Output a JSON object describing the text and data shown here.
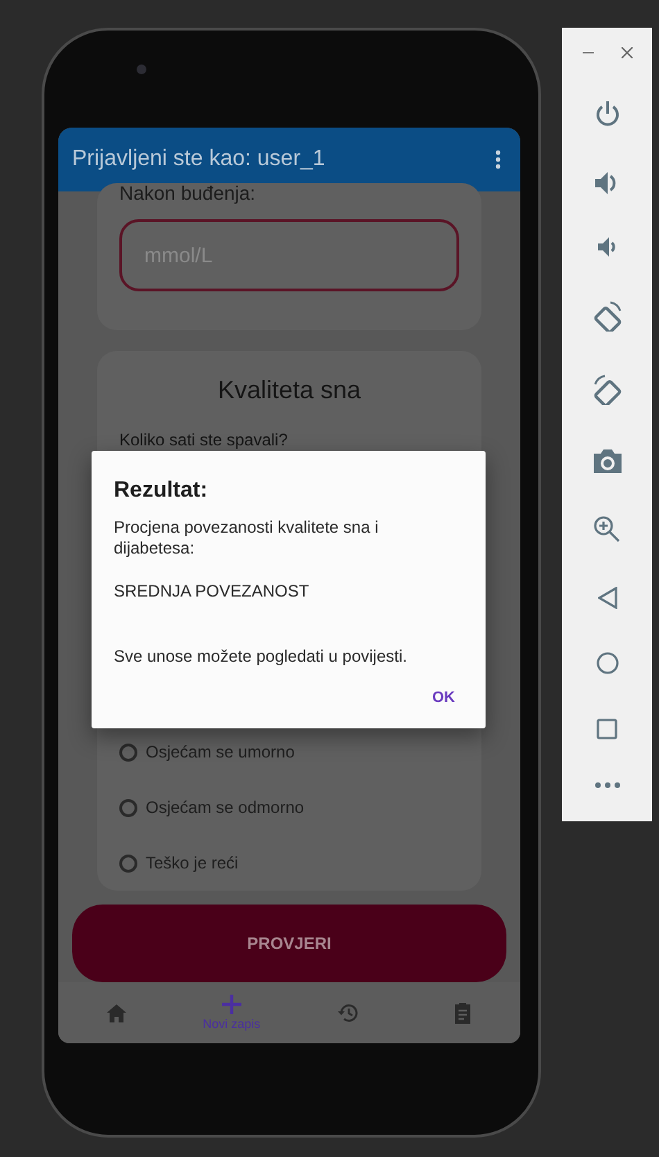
{
  "app_bar": {
    "title": "Prijavljeni ste kao: user_1"
  },
  "glucose_card": {
    "label": "Nakon buđenja:",
    "field": {
      "placeholder": "mmol/L"
    }
  },
  "sleep_card": {
    "title": "Kvaliteta sna",
    "question": "Koliko sati ste spavali?",
    "options": [
      {
        "label": "Osjećam se umorno",
        "selected": false
      },
      {
        "label": "Osjećam se odmorno",
        "selected": false
      },
      {
        "label": "Teško je reći",
        "selected": false
      }
    ]
  },
  "check_button": {
    "label": "PROVJERI"
  },
  "bottom_nav": [
    {
      "kind": "home",
      "selected": false
    },
    {
      "kind": "add",
      "label": "Novi zapis",
      "selected": true
    },
    {
      "kind": "history",
      "selected": false
    },
    {
      "kind": "clipboard",
      "selected": false
    }
  ],
  "dialog": {
    "title": "Rezultat:",
    "message": "Procjena povezanosti kvalitete sna i dijabetesa:",
    "result": "SREDNJA POVEZANOST",
    "note": "Sve unose možete pogledati u povijesti.",
    "action": "OK"
  }
}
